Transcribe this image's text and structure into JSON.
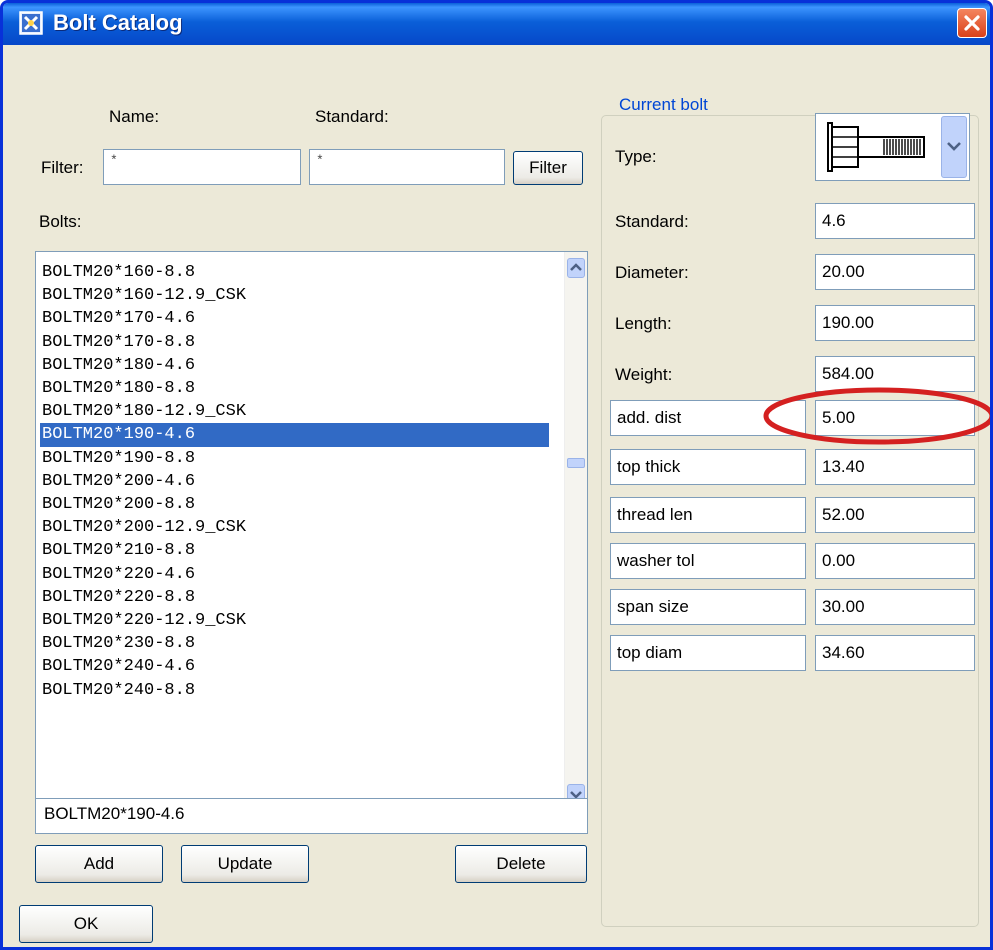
{
  "window": {
    "title": "Bolt Catalog",
    "accent": "#0a5fd8",
    "close_color": "#e8552a"
  },
  "filter": {
    "name_header": "Name:",
    "standard_header": "Standard:",
    "label": "Filter:",
    "name_value": "*",
    "standard_value": "*",
    "button": "Filter"
  },
  "bolts": {
    "label": "Bolts:",
    "items": [
      "BOLTM20*160-8.8",
      "BOLTM20*160-12.9_CSK",
      "BOLTM20*170-4.6",
      "BOLTM20*170-8.8",
      "BOLTM20*180-4.6",
      "BOLTM20*180-8.8",
      "BOLTM20*180-12.9_CSK",
      "BOLTM20*190-4.6",
      "BOLTM20*190-8.8",
      "BOLTM20*200-4.6",
      "BOLTM20*200-8.8",
      "BOLTM20*200-12.9_CSK",
      "BOLTM20*210-8.8",
      "BOLTM20*220-4.6",
      "BOLTM20*220-8.8",
      "BOLTM20*220-12.9_CSK",
      "BOLTM20*230-8.8",
      "BOLTM20*240-4.6",
      "BOLTM20*240-8.8"
    ],
    "selected": "BOLTM20*190-4.6",
    "selection_color": "#316ac5",
    "name_value": "BOLTM20*190-4.6"
  },
  "actions": {
    "add": "Add",
    "update": "Update",
    "delete": "Delete",
    "ok": "OK"
  },
  "current": {
    "legend": "Current bolt",
    "type_label": "Type:",
    "type_icon": "bolt-icon",
    "props": [
      {
        "label": "Standard:",
        "value": "4.6"
      },
      {
        "label": "Diameter:",
        "value": "20.00"
      },
      {
        "label": "Length:",
        "value": "190.00"
      },
      {
        "label": "Weight:",
        "value": "584.00"
      },
      {
        "label": "add. dist",
        "value": "5.00"
      },
      {
        "label": "top thick",
        "value": "13.40"
      },
      {
        "label": "thread len",
        "value": "52.00"
      },
      {
        "label": "washer tol",
        "value": "0.00"
      },
      {
        "label": "span size",
        "value": "30.00"
      },
      {
        "label": "top diam",
        "value": "34.60"
      }
    ],
    "highlight_color": "#d42020"
  }
}
